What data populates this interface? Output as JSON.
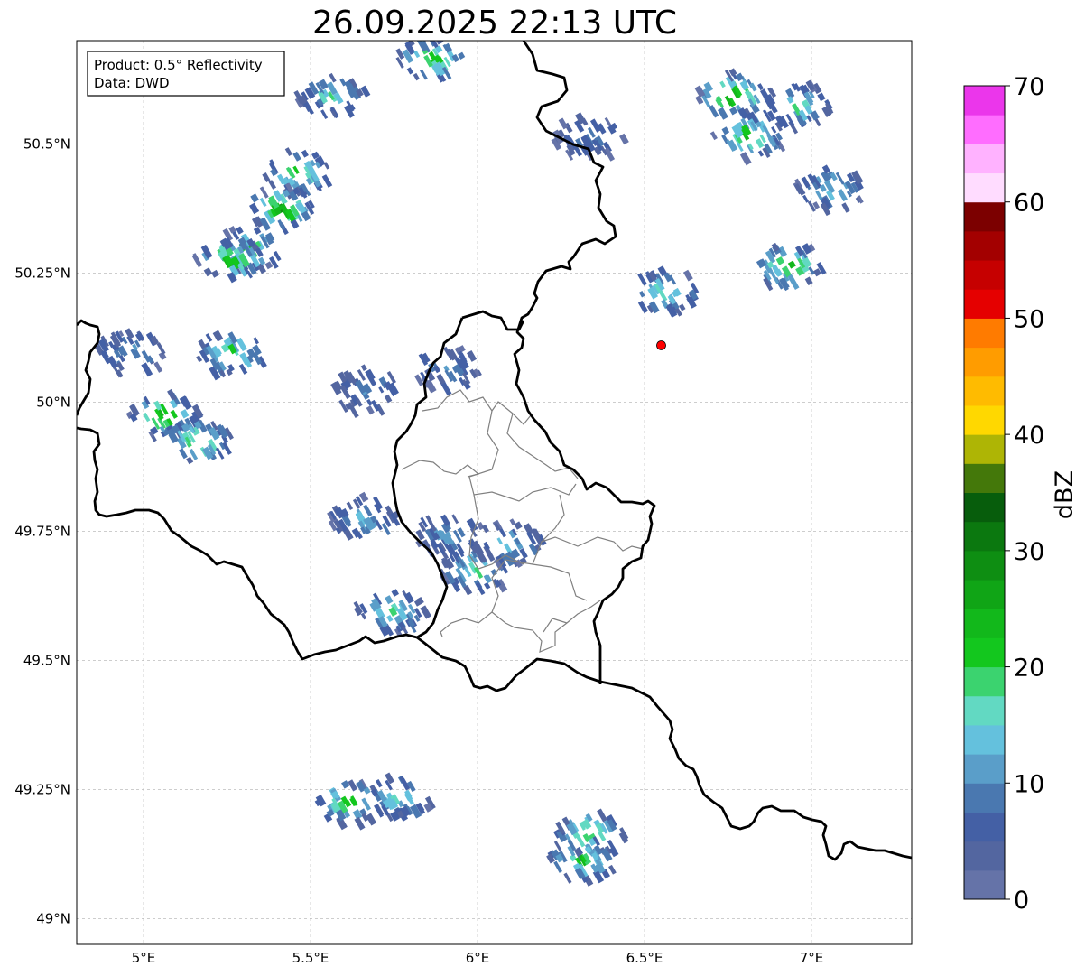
{
  "title": "26.09.2025 22:13 UTC",
  "info_box": {
    "product_line": "Product: 0.5° Reflectivity",
    "data_line": "Data: DWD"
  },
  "map": {
    "lon_range": [
      4.8,
      7.3
    ],
    "lat_range": [
      48.95,
      50.7
    ],
    "lon_ticks": [
      {
        "value": 5.0,
        "label": "5°E"
      },
      {
        "value": 5.5,
        "label": "5.5°E"
      },
      {
        "value": 6.0,
        "label": "6°E"
      },
      {
        "value": 6.5,
        "label": "6.5°E"
      },
      {
        "value": 7.0,
        "label": "7°E"
      }
    ],
    "lat_ticks": [
      {
        "value": 49.0,
        "label": "49°N"
      },
      {
        "value": 49.25,
        "label": "49.25°N"
      },
      {
        "value": 49.5,
        "label": "49.5°N"
      },
      {
        "value": 49.75,
        "label": "49.75°N"
      },
      {
        "value": 50.0,
        "label": "50°N"
      },
      {
        "value": 50.25,
        "label": "50.25°N"
      },
      {
        "value": 50.5,
        "label": "50.5°N"
      }
    ],
    "radar_site": {
      "lon": 6.55,
      "lat": 50.11,
      "color": "#ff0000"
    },
    "echo_cells": [
      {
        "lon": 5.55,
        "lat": 50.6,
        "dbz": 18
      },
      {
        "lon": 5.45,
        "lat": 50.45,
        "dbz": 24
      },
      {
        "lon": 5.4,
        "lat": 50.38,
        "dbz": 28
      },
      {
        "lon": 5.3,
        "lat": 50.3,
        "dbz": 24
      },
      {
        "lon": 5.25,
        "lat": 50.28,
        "dbz": 26
      },
      {
        "lon": 5.85,
        "lat": 50.67,
        "dbz": 24
      },
      {
        "lon": 6.32,
        "lat": 50.52,
        "dbz": 10
      },
      {
        "lon": 6.75,
        "lat": 50.6,
        "dbz": 30
      },
      {
        "lon": 6.8,
        "lat": 50.52,
        "dbz": 26
      },
      {
        "lon": 6.95,
        "lat": 50.58,
        "dbz": 18
      },
      {
        "lon": 7.05,
        "lat": 50.42,
        "dbz": 16
      },
      {
        "lon": 6.92,
        "lat": 50.27,
        "dbz": 26
      },
      {
        "lon": 6.55,
        "lat": 50.22,
        "dbz": 18
      },
      {
        "lon": 5.25,
        "lat": 50.1,
        "dbz": 22
      },
      {
        "lon": 4.95,
        "lat": 50.1,
        "dbz": 12
      },
      {
        "lon": 5.05,
        "lat": 49.98,
        "dbz": 28
      },
      {
        "lon": 5.15,
        "lat": 49.93,
        "dbz": 24
      },
      {
        "lon": 5.65,
        "lat": 50.03,
        "dbz": 10
      },
      {
        "lon": 5.9,
        "lat": 50.07,
        "dbz": 10
      },
      {
        "lon": 5.65,
        "lat": 49.78,
        "dbz": 14
      },
      {
        "lon": 5.9,
        "lat": 49.75,
        "dbz": 12
      },
      {
        "lon": 5.98,
        "lat": 49.68,
        "dbz": 20
      },
      {
        "lon": 6.08,
        "lat": 49.73,
        "dbz": 14
      },
      {
        "lon": 5.73,
        "lat": 49.6,
        "dbz": 20
      },
      {
        "lon": 5.6,
        "lat": 49.23,
        "dbz": 24
      },
      {
        "lon": 5.75,
        "lat": 49.24,
        "dbz": 18
      },
      {
        "lon": 6.32,
        "lat": 49.17,
        "dbz": 24
      },
      {
        "lon": 6.3,
        "lat": 49.12,
        "dbz": 22
      }
    ]
  },
  "colorbar": {
    "label": "dBZ",
    "min": 0,
    "max": 70,
    "tick_values": [
      {
        "value": 0,
        "label": "0"
      },
      {
        "value": 10,
        "label": "10"
      },
      {
        "value": 20,
        "label": "20"
      },
      {
        "value": 30,
        "label": "30"
      },
      {
        "value": 40,
        "label": "40"
      },
      {
        "value": 50,
        "label": "50"
      },
      {
        "value": 60,
        "label": "60"
      },
      {
        "value": 70,
        "label": "70"
      }
    ],
    "colors": [
      "#6573a8",
      "#5366a0",
      "#4460a5",
      "#4a78b0",
      "#5a9ec9",
      "#64c1dd",
      "#62d9c2",
      "#3bd36f",
      "#13c71e",
      "#12b81b",
      "#10a516",
      "#0e8e12",
      "#0b780f",
      "#075d0c",
      "#44780a",
      "#aeb505",
      "#ffd800",
      "#ffbb00",
      "#ff9c00",
      "#ff7b00",
      "#e50000",
      "#c60000",
      "#a30000",
      "#7c0000",
      "#ffdcff",
      "#ffb2ff",
      "#ff6dff",
      "#eb36eb"
    ]
  }
}
